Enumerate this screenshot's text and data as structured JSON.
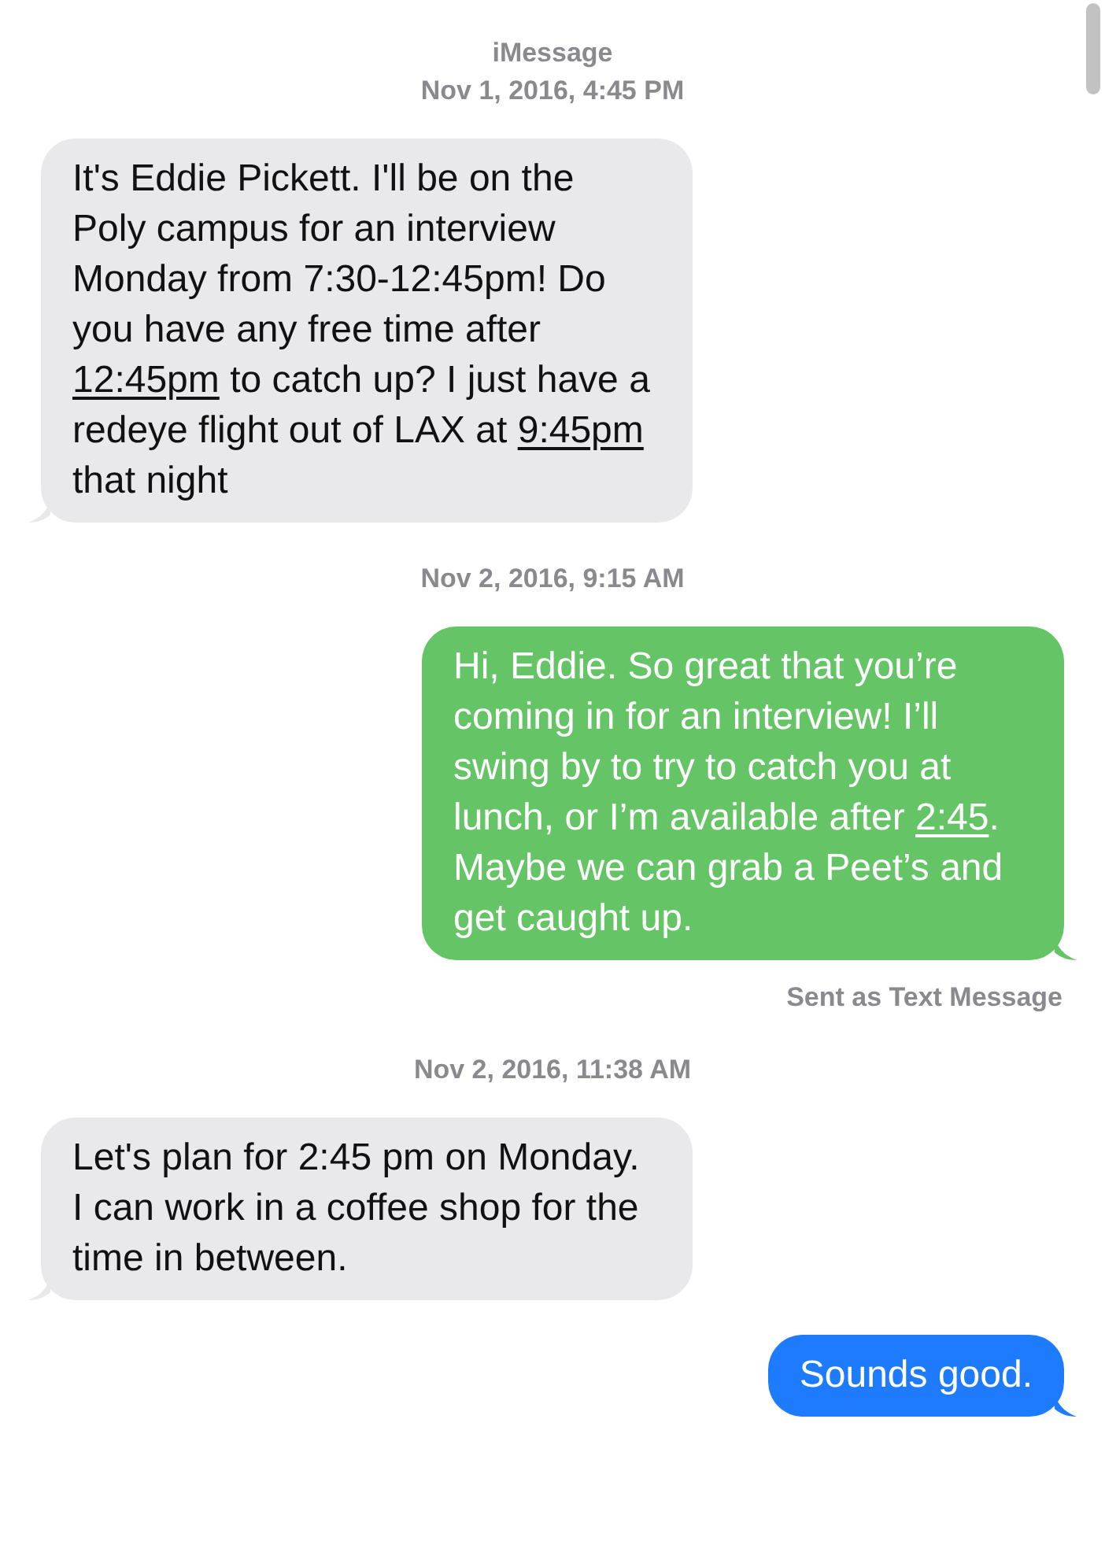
{
  "header": {
    "service": "iMessage",
    "timestamp": "Nov 1, 2016, 4:45 PM"
  },
  "items": [
    {
      "kind": "received",
      "color": "#e9e9eb",
      "segments": [
        {
          "text": "It's Eddie Pickett. I'll be on the Poly campus for an interview Monday from 7:30-12:45pm! Do you have any free time after ",
          "link": false
        },
        {
          "text": "12:45pm",
          "link": true
        },
        {
          "text": " to catch up? I just have a redeye flight out of LAX at ",
          "link": false
        },
        {
          "text": "9:45pm",
          "link": true
        },
        {
          "text": " that night",
          "link": false
        }
      ]
    },
    {
      "kind": "timestamp",
      "text": "Nov 2, 2016, 9:15 AM"
    },
    {
      "kind": "sent",
      "color": "#65c466",
      "segments": [
        {
          "text": "Hi, Eddie. So great that you’re coming in for an interview! I’ll swing by to try to catch you at lunch, or I’m available after ",
          "link": false
        },
        {
          "text": "2:45",
          "link": true
        },
        {
          "text": ". Maybe we can grab a Peet’s and get caught up.",
          "link": false
        }
      ]
    },
    {
      "kind": "status",
      "text": "Sent as Text Message"
    },
    {
      "kind": "timestamp",
      "text": "Nov 2, 2016, 11:38 AM"
    },
    {
      "kind": "received",
      "color": "#e9e9eb",
      "segments": [
        {
          "text": "Let's plan for 2:45 pm on Monday. I can work in a coffee shop for the time in between.",
          "link": false
        }
      ]
    },
    {
      "kind": "sent",
      "color": "#1f7bfd",
      "segments": [
        {
          "text": "Sounds good.",
          "link": false
        }
      ]
    }
  ]
}
